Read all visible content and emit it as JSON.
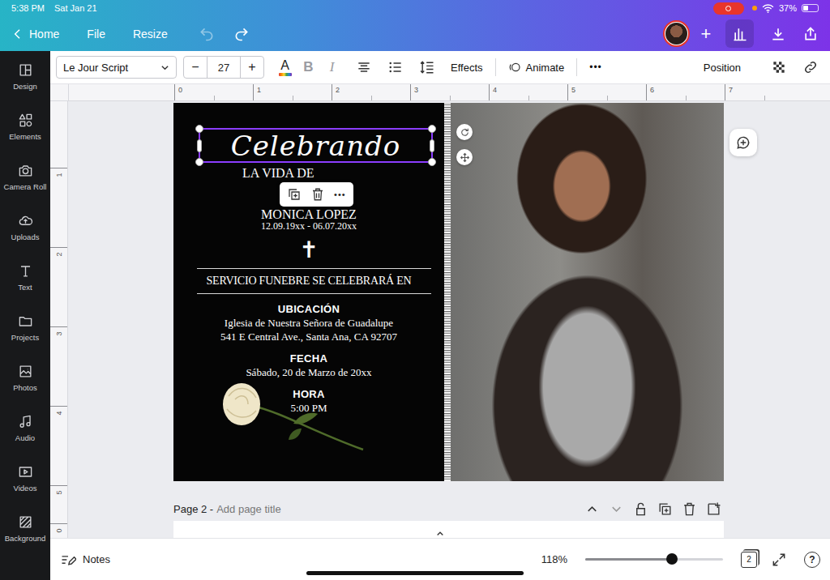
{
  "status_bar": {
    "time": "5:38 PM",
    "date": "Sat Jan 21",
    "battery": "37%",
    "battery_level": 0.37,
    "recording": true
  },
  "top_bar": {
    "home": "Home",
    "menus": [
      "File",
      "Resize"
    ],
    "undo": {
      "disabled": true
    },
    "redo": {
      "disabled": false
    },
    "add": "+"
  },
  "toolbar": {
    "font": "Le Jour Script",
    "font_size": "27",
    "decrease": "−",
    "increase": "+",
    "text_color": "A",
    "bold": {
      "label": "B",
      "disabled": true
    },
    "italic": {
      "label": "I",
      "disabled": true
    },
    "effects": "Effects",
    "animate": "Animate",
    "more": "•••",
    "position": "Position"
  },
  "sidebar": {
    "items": [
      {
        "label": "Design",
        "selected": false
      },
      {
        "label": "Elements",
        "selected": false
      },
      {
        "label": "Camera Roll",
        "selected": false
      },
      {
        "label": "Uploads",
        "selected": false
      },
      {
        "label": "Text",
        "selected": false
      },
      {
        "label": "Projects",
        "selected": false
      },
      {
        "label": "Photos",
        "selected": false
      },
      {
        "label": "Audio",
        "selected": false
      },
      {
        "label": "Videos",
        "selected": false
      },
      {
        "label": "Background",
        "selected": false
      }
    ]
  },
  "rulers": {
    "horizontal": [
      "0",
      "1",
      "2",
      "3",
      "4",
      "5",
      "6",
      "7"
    ],
    "vertical": [
      "1",
      "2",
      "3",
      "4",
      "5",
      "0"
    ]
  },
  "design": {
    "heading": "Celebrando",
    "heading_selected": true,
    "subheading": "LA VIDA DE",
    "name": "MONICA LOPEZ",
    "dates": "12.09.19xx - 06.07.20xx",
    "cross": "✝",
    "service": "SERVICIO FUNEBRE SE CELEBRARÁ EN",
    "details": [
      {
        "title": "UBICACIÓN",
        "lines": [
          "Iglesia de Nuestra Señora de Guadalupe",
          "541 E Central Ave., Santa Ana, CA 92707"
        ]
      },
      {
        "title": "FECHA",
        "lines": [
          "Sábado, 20 de Marzo de 20xx"
        ]
      },
      {
        "title": "HORA",
        "lines": [
          "5:00 PM"
        ]
      }
    ]
  },
  "context_menu": {
    "more": "•••"
  },
  "page2": {
    "label": "Page 2 -",
    "placeholder": "Add page title"
  },
  "bottom_bar": {
    "notes": "Notes",
    "zoom": "118%",
    "zoom_level": 0.63,
    "page_count": "2",
    "help": "?"
  }
}
